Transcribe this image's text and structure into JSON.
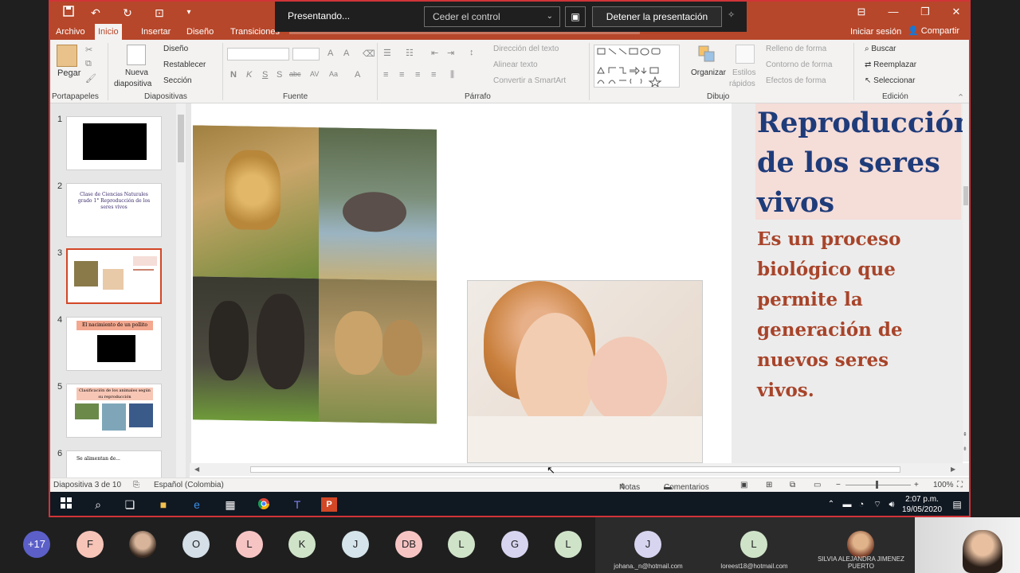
{
  "presenting": {
    "status_label": "Presentando...",
    "control_select_value": "Ceder el control",
    "stop_label": "Detener la presentación"
  },
  "titlebar": {
    "iniciar_sesion": "Iniciar sesión",
    "compartir": "Compartir"
  },
  "tabs": [
    "Archivo",
    "Inicio",
    "Insertar",
    "Diseño",
    "Transiciones"
  ],
  "ribbon": {
    "portapapeles": {
      "pegar": "Pegar",
      "label": "Portapapeles"
    },
    "diapositivas": {
      "nueva": "Nueva",
      "diapositiva": "diapositiva",
      "diseno": "Diseño",
      "restablecer": "Restablecer",
      "seccion": "Sección",
      "label": "Diapositivas"
    },
    "fuente": {
      "label": "Fuente",
      "format_letters": [
        "N",
        "K",
        "S",
        "S",
        "abc",
        "AV",
        "Aa",
        "A"
      ]
    },
    "parrafo": {
      "direccion": "Dirección del texto",
      "alinear": "Alinear texto",
      "convertir": "Convertir a SmartArt",
      "label": "Párrafo"
    },
    "dibujo": {
      "organizar": "Organizar",
      "estilos": "Estilos",
      "rapidos": "rápidos",
      "relleno": "Relleno de forma",
      "contorno": "Contorno de forma",
      "efectos": "Efectos de forma",
      "label": "Dibujo"
    },
    "edicion": {
      "buscar": "Buscar",
      "reemplazar": "Reemplazar",
      "seleccionar": "Seleccionar",
      "label": "Edición"
    }
  },
  "thumbnails": [
    {
      "num": "1",
      "text": ""
    },
    {
      "num": "2",
      "text": "Clase de Ciencias Naturales grado 1° Reproducción de los seres vivos"
    },
    {
      "num": "3",
      "text": ""
    },
    {
      "num": "4",
      "text": "El nacimiento de un pollito"
    },
    {
      "num": "5",
      "text": "Clasificación de los animales según su reproducción"
    },
    {
      "num": "6",
      "text": "Se alimentan de..."
    }
  ],
  "slide": {
    "title": [
      "Reproducción",
      "de los seres",
      "vivos"
    ],
    "body": [
      "Es un proceso",
      "biológico que",
      "permite la",
      "generación de",
      "nuevos seres",
      "vivos."
    ]
  },
  "statusbar": {
    "slide_count": "Diapositiva 3 de 10",
    "language": "Español (Colombia)",
    "notas": "Notas",
    "comentarios": "Comentarios",
    "zoom": "100%"
  },
  "taskbar": {
    "time": "2:07 p.m.",
    "date": "19/05/2020"
  },
  "participants": {
    "more": "+17",
    "initials": [
      "F",
      "",
      "O",
      "L",
      "K",
      "J",
      "DB",
      "L",
      "G",
      "L"
    ],
    "tiles": [
      {
        "initial": "J",
        "email": "johana._n@hotmail.com"
      },
      {
        "initial": "L",
        "email": "loreest18@hotmail.com"
      },
      {
        "initial": "",
        "email": "SILVIA ALEJANDRA JIMENEZ PUERTO"
      }
    ]
  },
  "colors": {
    "ppt_red": "#b7472a",
    "title_blue": "#1f3c7a",
    "body_red": "#a8442a"
  }
}
